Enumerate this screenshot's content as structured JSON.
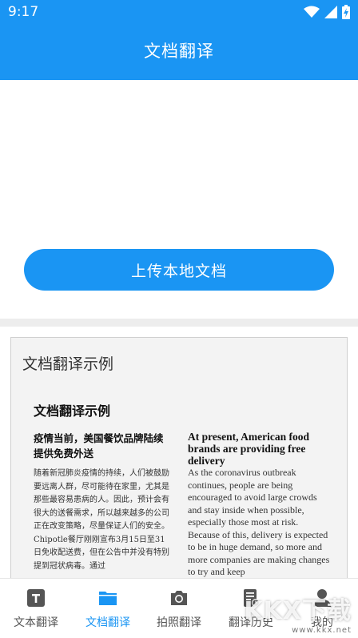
{
  "status": {
    "time": "9:17"
  },
  "header": {
    "title": "文档翻译"
  },
  "upload": {
    "button_label": "上传本地文档"
  },
  "example": {
    "card_title": "文档翻译示例",
    "doc_heading": "文档翻译示例",
    "zh_headline": "疫情当前，美国餐饮品牌陆续提供免费外送",
    "zh_body": "随着新冠肺炎疫情的持续，人们被鼓励要远离人群，尽可能待在家里，尤其是那些最容易患病的人。因此，预计会有很大的送餐需求，所以越来越多的公司正在改变策略，尽量保证人们的安全。Chipotle餐厅刚刚宣布3月15日至31日免收配送费，但在公告中并没有特别提到冠状病毒。通过",
    "en_headline": "At present, American food brands are providing free delivery",
    "en_body": "As the coronavirus outbreak continues, people are being encouraged to avoid large crowds and stay inside when possible, especially those most at risk. Because of this, delivery is expected to be in huge demand, so more and more companies are making changes to try and keep"
  },
  "tabs": [
    {
      "label": "文本翻译",
      "icon": "text-icon"
    },
    {
      "label": "文档翻译",
      "icon": "folder-icon"
    },
    {
      "label": "拍照翻译",
      "icon": "camera-icon"
    },
    {
      "label": "翻译历史",
      "icon": "history-icon"
    },
    {
      "label": "我的",
      "icon": "profile-icon"
    }
  ],
  "watermark": {
    "text": "KKX下载",
    "url": "www.kkx.net"
  },
  "colors": {
    "accent": "#1a95f3",
    "tab_inactive": "#555555"
  }
}
